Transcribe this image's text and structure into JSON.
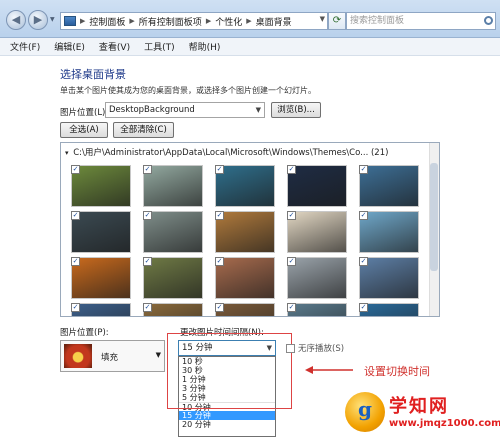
{
  "breadcrumbs": [
    "控制面板",
    "所有控制面板项",
    "个性化",
    "桌面背景"
  ],
  "search": {
    "placeholder": "搜索控制面板"
  },
  "menu": [
    "文件(F)",
    "编辑(E)",
    "查看(V)",
    "工具(T)",
    "帮助(H)"
  ],
  "main": {
    "title": "选择桌面背景",
    "description": "单击某个图片使其成为您的桌面背景，或选择多个图片创建一个幻灯片。",
    "location_label": "图片位置(L):",
    "location_value": "DesktopBackground",
    "browse_label": "浏览(B)...",
    "select_all_label": "全选(A)",
    "clear_all_label": "全部清除(C)"
  },
  "gallery": {
    "header": "C:\\用户\\Administrator\\AppData\\Local\\Microsoft\\Windows\\Themes\\Co... (21)",
    "checkmark": "✓",
    "tiles": [
      "#6d8a3c",
      "#93a9a0",
      "#2f6f8c",
      "#1e2c44",
      "#3d6f96",
      "#3b4a52",
      "#7f8e8a",
      "#b07a3c",
      "#e2d7c3",
      "#6fa7c9",
      "#c96a1d",
      "#6f7a45",
      "#a76b4d",
      "#9aa3aa",
      "#5d7fa6",
      "#3c5f8a",
      "#8a6a3c",
      "#7a5a3a",
      "#5a7a8c",
      "#2a6a9a"
    ]
  },
  "bottom": {
    "position_label": "图片位置(P):",
    "position_value": "填充",
    "interval_label": "更改图片时间间隔(N):",
    "interval_value": "15 分钟",
    "options": [
      "10 秒",
      "30 秒",
      "1 分钟",
      "3 分钟",
      "5 分钟",
      "10 分钟",
      "15 分钟",
      "20 分钟"
    ],
    "selected_option": "15 分钟",
    "shuffle_label": "无序播放(S)",
    "annotation": "设置切换时间"
  },
  "watermark": {
    "mark": "g",
    "name": "学知网",
    "url": "www.jmqz1000.com"
  }
}
